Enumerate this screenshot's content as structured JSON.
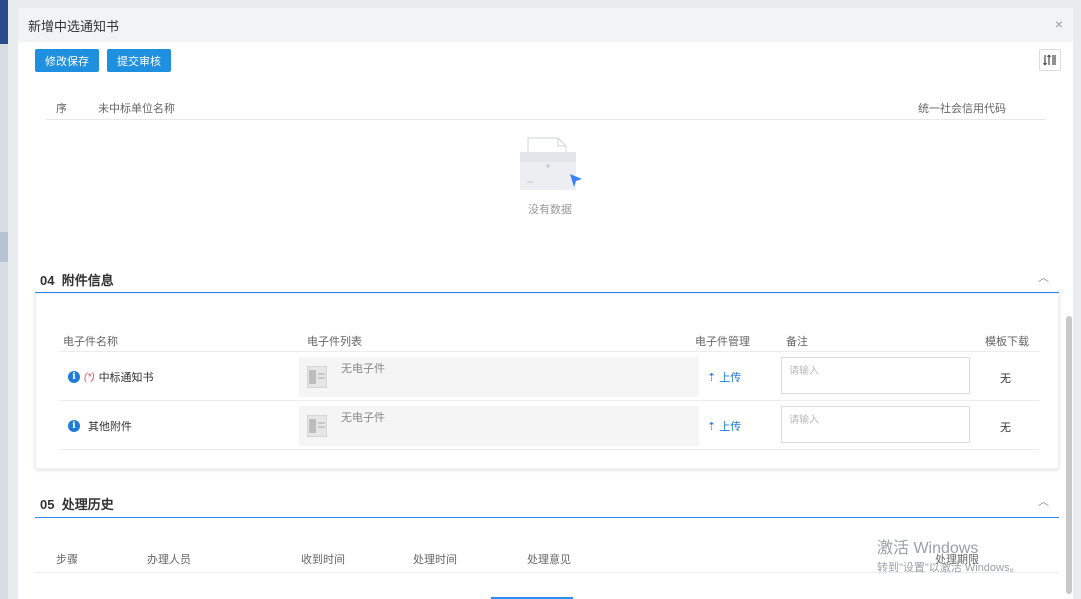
{
  "modal": {
    "title": "新增中选通知书",
    "close_symbol": "×"
  },
  "toolbar": {
    "save_label": "修改保存",
    "submit_label": "提交审核"
  },
  "bidder_grid": {
    "columns": [
      "序",
      "未中标单位名称",
      "统一社会信用代码"
    ],
    "empty_text": "没有数据"
  },
  "attachments": {
    "section_number": "04",
    "section_title": "附件信息",
    "columns": [
      "电子件名称",
      "电子件列表",
      "电子件管理",
      "备注",
      "模板下载"
    ],
    "rows": [
      {
        "name": "中标通知书",
        "required_mark": "(*)",
        "file_status": "无电子件",
        "upload_label": "上传",
        "remark_value": "",
        "remark_placeholder": "请输入",
        "template": "无"
      },
      {
        "name": "其他附件",
        "required_mark": "",
        "file_status": "无电子件",
        "upload_label": "上传",
        "remark_value": "",
        "remark_placeholder": "请输入",
        "template": "无"
      }
    ]
  },
  "history": {
    "section_number": "05",
    "section_title": "处理历史",
    "columns": [
      "步骤",
      "办理人员",
      "收到时间",
      "处理时间",
      "处理意见",
      "处理期限"
    ]
  },
  "watermark": {
    "line1": "激活 Windows",
    "line2": "转到\"设置\"以激活 Windows。"
  },
  "colors": {
    "primary": "#1f8fe0",
    "accent_line": "#2d8cf0",
    "link": "#1f7bd8",
    "required": "#e34c4c",
    "sidebar_accent": "#2d4a8a"
  },
  "icons": {
    "close": "close-icon",
    "filter": "column-settings-icon",
    "collapse": "chevron-up-icon",
    "info": "info-icon",
    "upload": "upload-icon",
    "file": "document-icon",
    "empty": "empty-folder-icon"
  }
}
